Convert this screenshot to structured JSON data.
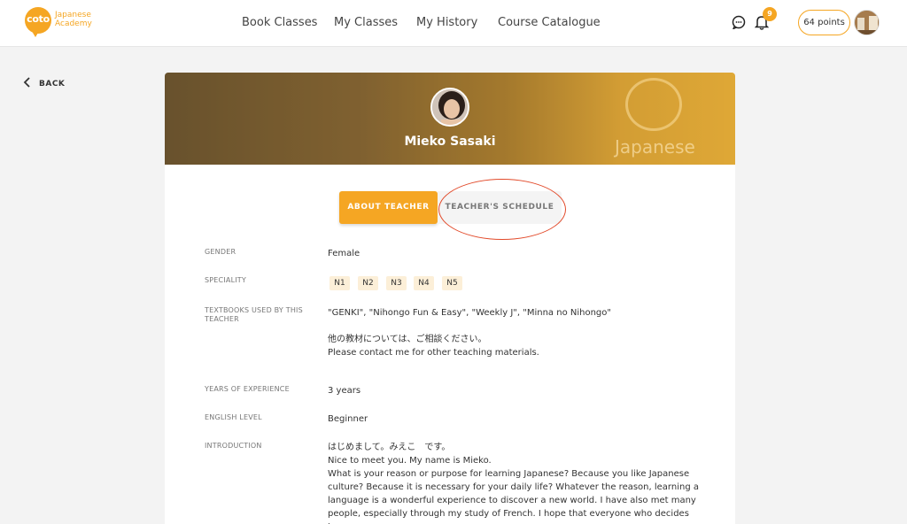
{
  "header": {
    "logo": {
      "badge": "coto",
      "line1": "Japanese",
      "line2": "Academy"
    },
    "nav": [
      "Book Classes",
      "My Classes",
      "My History",
      "Course Catalogue"
    ],
    "notification_count": "9",
    "points": "64 points",
    "icons": {
      "chat": "chat-bubble-icon",
      "bell": "bell-icon"
    }
  },
  "back": {
    "label": "BACK"
  },
  "teacher": {
    "name": "Mieko Sasaki"
  },
  "tabs": {
    "about": "ABOUT TEACHER",
    "schedule": "TEACHER'S SCHEDULE"
  },
  "details": {
    "gender": {
      "label": "GENDER",
      "value": "Female"
    },
    "speciality": {
      "label": "SPECIALITY",
      "items": [
        "N1",
        "N2",
        "N3",
        "N4",
        "N5"
      ]
    },
    "textbooks": {
      "label": "TEXTBOOKS USED BY THIS TEACHER",
      "line1": "\"GENKI\", \"Nihongo Fun & Easy\", \"Weekly J\", \"Minna no Nihongo\"",
      "line2": "他の教材については、ご相談ください。",
      "line3": "Please contact me for other teaching materials."
    },
    "experience": {
      "label": "YEARS OF EXPERIENCE",
      "value": "3 years"
    },
    "english": {
      "label": "ENGLISH LEVEL",
      "value": "Beginner"
    },
    "introduction": {
      "label": "INTRODUCTION",
      "lines": [
        "はじめまして。みえこ　です。",
        "Nice to meet you. My name is Mieko.",
        "What is your reason or purpose for learning Japanese? Because you like Japanese",
        "culture? Because it is necessary for your daily life? Whatever the reason, learning a",
        "language is a wonderful experience to discover a new world. I have also met many",
        "people, especially through my study of French. I hope that everyone who decides to"
      ]
    }
  },
  "colors": {
    "accent": "#f5a623",
    "highlight": "#e24a2a"
  }
}
